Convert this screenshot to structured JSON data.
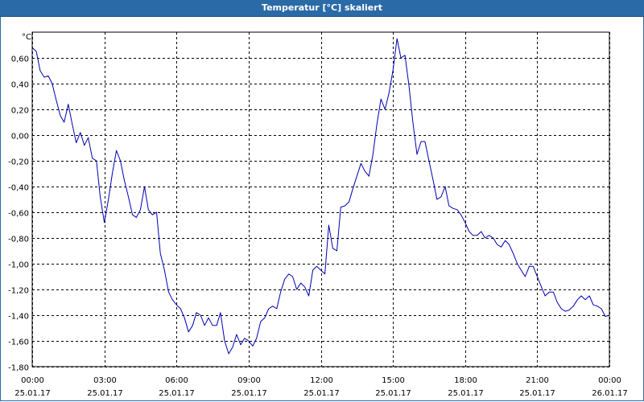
{
  "window": {
    "title": "Temperatur [°C] skaliert"
  },
  "colors": {
    "titlebar": "#2a6aa6",
    "series": "#0000b4",
    "grid": "#000000"
  },
  "chart_data": {
    "type": "line",
    "title": "Temperatur [°C] skaliert",
    "ylabel": "°C",
    "xlabel": "",
    "ylim": [
      -1.8,
      0.8
    ],
    "y_ticks": [
      0.6,
      0.4,
      0.2,
      0.0,
      -0.2,
      -0.4,
      -0.6,
      -0.8,
      -1.0,
      -1.2,
      -1.4,
      -1.6,
      -1.8
    ],
    "y_tick_labels": [
      "0,60",
      "0,40",
      "0,20",
      "0,00",
      "-0,20",
      "-0,40",
      "-0,60",
      "-0,80",
      "-1,00",
      "-1,20",
      "-1,40",
      "-1,60",
      "-1,80"
    ],
    "x_range_hours": [
      0,
      24
    ],
    "x_ticks": [
      0,
      3,
      6,
      9,
      12,
      15,
      18,
      21,
      24
    ],
    "x_tick_labels": [
      [
        "00:00",
        "25.01.17"
      ],
      [
        "03:00",
        "25.01.17"
      ],
      [
        "06:00",
        "25.01.17"
      ],
      [
        "09:00",
        "25.01.17"
      ],
      [
        "12:00",
        "25.01.17"
      ],
      [
        "15:00",
        "25.01.17"
      ],
      [
        "18:00",
        "25.01.17"
      ],
      [
        "21:00",
        "25.01.17"
      ],
      [
        "00:00",
        "26.01.17"
      ]
    ],
    "grid": true,
    "series": [
      {
        "x": [
          0,
          0.17,
          0.33,
          0.5,
          0.67,
          0.83,
          1.0,
          1.17,
          1.33,
          1.5,
          1.67,
          1.83,
          2.0,
          2.17,
          2.33,
          2.5,
          2.67,
          2.83,
          3.0,
          3.17,
          3.33,
          3.5,
          3.67,
          3.83,
          4.0,
          4.17,
          4.33,
          4.5,
          4.67,
          4.83,
          5.0,
          5.17,
          5.33,
          5.5,
          5.67,
          5.83,
          6.0,
          6.17,
          6.33,
          6.5,
          6.67,
          6.83,
          7.0,
          7.17,
          7.33,
          7.5,
          7.67,
          7.83,
          8.0,
          8.17,
          8.33,
          8.5,
          8.67,
          8.83,
          9.0,
          9.17,
          9.33,
          9.5,
          9.67,
          9.83,
          10.0,
          10.17,
          10.33,
          10.5,
          10.67,
          10.83,
          11.0,
          11.17,
          11.33,
          11.5,
          11.67,
          11.83,
          12.0,
          12.17,
          12.33,
          12.5,
          12.67,
          12.83,
          13.0,
          13.17,
          13.33,
          13.5,
          13.67,
          13.83,
          14.0,
          14.17,
          14.33,
          14.5,
          14.67,
          14.83,
          15.0,
          15.17,
          15.33,
          15.5,
          15.67,
          15.83,
          16.0,
          16.17,
          16.33,
          16.5,
          16.67,
          16.83,
          17.0,
          17.17,
          17.33,
          17.5,
          17.67,
          17.83,
          18.0,
          18.17,
          18.33,
          18.5,
          18.67,
          18.83,
          19.0,
          19.17,
          19.33,
          19.5,
          19.67,
          19.83,
          20.0,
          20.17,
          20.33,
          20.5,
          20.67,
          20.83,
          21.0,
          21.17,
          21.33,
          21.5,
          21.67,
          21.83,
          22.0,
          22.17,
          22.33,
          22.5,
          22.67,
          22.83,
          23.0,
          23.17,
          23.33,
          23.5,
          23.67,
          23.83,
          24.0
        ],
        "y": [
          0.68,
          0.65,
          0.5,
          0.45,
          0.46,
          0.4,
          0.27,
          0.15,
          0.1,
          0.24,
          0.08,
          -0.06,
          0.02,
          -0.08,
          -0.02,
          -0.18,
          -0.2,
          -0.48,
          -0.68,
          -0.5,
          -0.3,
          -0.12,
          -0.2,
          -0.35,
          -0.48,
          -0.62,
          -0.64,
          -0.58,
          -0.4,
          -0.58,
          -0.62,
          -0.6,
          -0.92,
          -1.05,
          -1.22,
          -1.28,
          -1.32,
          -1.35,
          -1.42,
          -1.53,
          -1.48,
          -1.38,
          -1.4,
          -1.48,
          -1.42,
          -1.48,
          -1.48,
          -1.38,
          -1.6,
          -1.7,
          -1.65,
          -1.55,
          -1.63,
          -1.58,
          -1.6,
          -1.64,
          -1.58,
          -1.45,
          -1.42,
          -1.35,
          -1.33,
          -1.35,
          -1.22,
          -1.12,
          -1.08,
          -1.1,
          -1.2,
          -1.15,
          -1.18,
          -1.25,
          -1.05,
          -1.02,
          -1.05,
          -1.08,
          -0.7,
          -0.88,
          -0.9,
          -0.56,
          -0.55,
          -0.52,
          -0.42,
          -0.32,
          -0.22,
          -0.28,
          -0.32,
          -0.15,
          0.08,
          0.28,
          0.2,
          0.32,
          0.5,
          0.75,
          0.6,
          0.62,
          0.38,
          0.1,
          -0.15,
          -0.05,
          -0.05,
          -0.2,
          -0.35,
          -0.5,
          -0.48,
          -0.4,
          -0.55,
          -0.57,
          -0.58,
          -0.62,
          -0.68,
          -0.75,
          -0.78,
          -0.78,
          -0.75,
          -0.8,
          -0.78,
          -0.8,
          -0.85,
          -0.87,
          -0.82,
          -0.85,
          -0.92,
          -1.0,
          -1.05,
          -1.1,
          -1.02,
          -1.02,
          -1.1,
          -1.18,
          -1.25,
          -1.22,
          -1.22,
          -1.3,
          -1.35,
          -1.37,
          -1.36,
          -1.33,
          -1.28,
          -1.25,
          -1.28,
          -1.25,
          -1.32,
          -1.33,
          -1.35,
          -1.41,
          -1.4
        ]
      }
    ]
  }
}
